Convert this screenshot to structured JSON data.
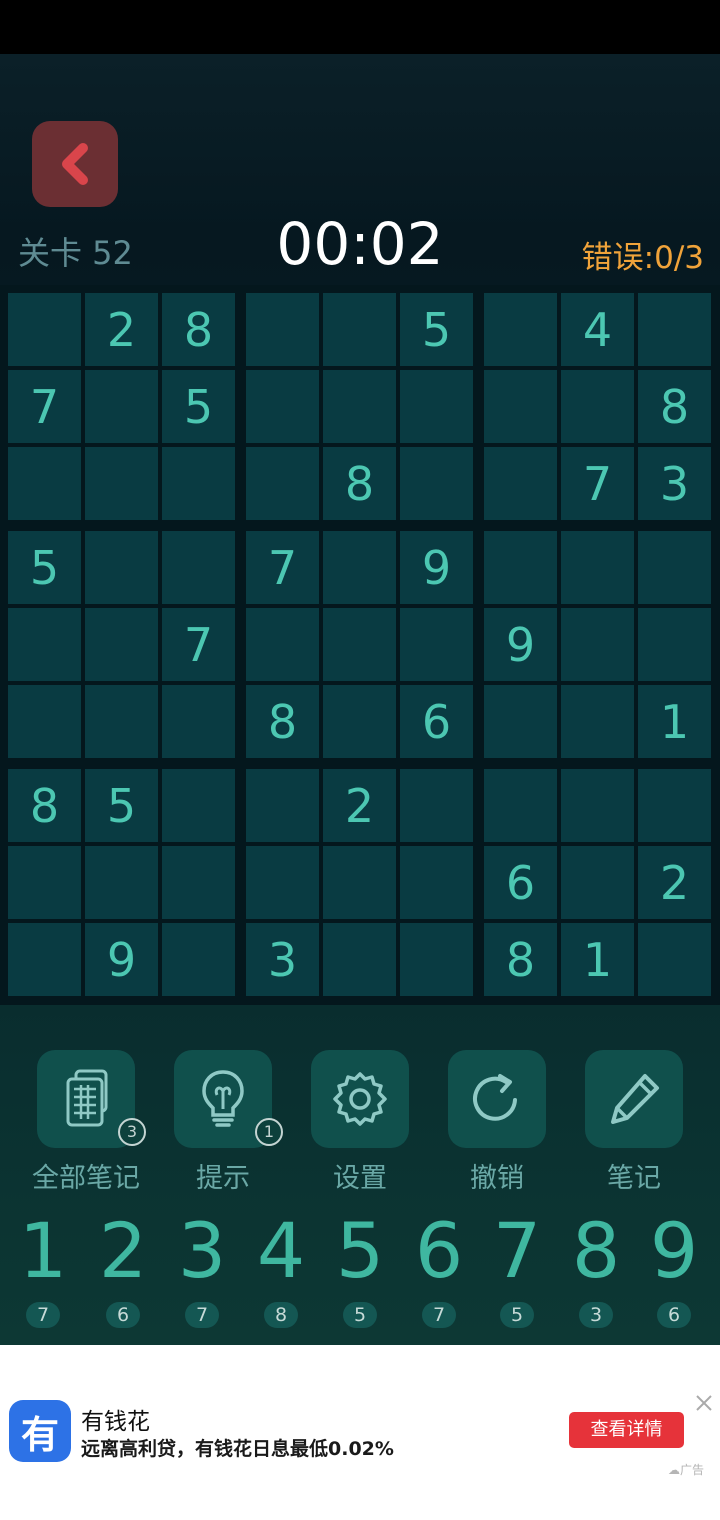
{
  "header": {
    "level": "关卡 52",
    "timer": "00:02",
    "errors": "错误:0/3"
  },
  "board": [
    [
      "",
      "2",
      "8",
      "",
      "",
      "5",
      "",
      "4",
      ""
    ],
    [
      "7",
      "",
      "5",
      "",
      "",
      "",
      "",
      "",
      "8"
    ],
    [
      "",
      "",
      "",
      "",
      "8",
      "",
      "",
      "7",
      "3"
    ],
    [
      "5",
      "",
      "",
      "7",
      "",
      "9",
      "",
      "",
      ""
    ],
    [
      "",
      "",
      "7",
      "",
      "",
      "",
      "9",
      "",
      ""
    ],
    [
      "",
      "",
      "",
      "8",
      "",
      "6",
      "",
      "",
      "1"
    ],
    [
      "8",
      "5",
      "",
      "",
      "2",
      "",
      "",
      "",
      ""
    ],
    [
      "",
      "",
      "",
      "",
      "",
      "",
      "6",
      "",
      "2"
    ],
    [
      "",
      "9",
      "",
      "3",
      "",
      "",
      "8",
      "1",
      ""
    ]
  ],
  "tools": [
    {
      "label": "全部笔记",
      "icon": "all-notes-icon",
      "badge": "3"
    },
    {
      "label": "提示",
      "icon": "lightbulb-icon",
      "badge": "1"
    },
    {
      "label": "设置",
      "icon": "gear-icon",
      "badge": ""
    },
    {
      "label": "撤销",
      "icon": "undo-icon",
      "badge": ""
    },
    {
      "label": "笔记",
      "icon": "pencil-icon",
      "badge": ""
    }
  ],
  "numpad": [
    {
      "digit": "1",
      "count": "7"
    },
    {
      "digit": "2",
      "count": "6"
    },
    {
      "digit": "3",
      "count": "7"
    },
    {
      "digit": "4",
      "count": "8"
    },
    {
      "digit": "5",
      "count": "5"
    },
    {
      "digit": "6",
      "count": "7"
    },
    {
      "digit": "7",
      "count": "5"
    },
    {
      "digit": "8",
      "count": "3"
    },
    {
      "digit": "9",
      "count": "6"
    }
  ],
  "ad": {
    "logo_char": "有",
    "title": "有钱花",
    "description": "远离高利贷，有钱花日息最低0.02%",
    "cta": "查看详情",
    "tag": "☁广告"
  },
  "colors": {
    "background": "#062128",
    "cell": "#093b42",
    "digit": "#4cc7b2",
    "timer": "#ffffff",
    "errors": "#f0a33a",
    "back_button": "#6b2f33",
    "ad_cta": "#e6333a"
  }
}
